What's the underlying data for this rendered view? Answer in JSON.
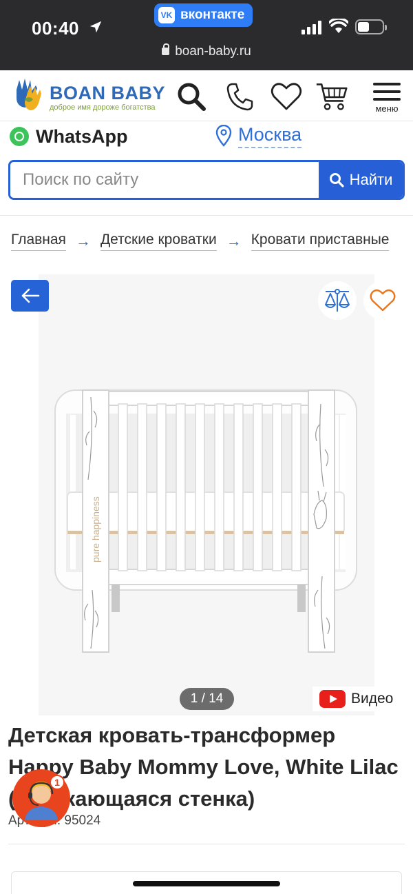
{
  "status_bar": {
    "time": "00:40",
    "back_app": "вконтакте",
    "vk_glyph": "VK",
    "url": "boan-baby.ru"
  },
  "header": {
    "logo_name": "BOAN BABY",
    "logo_tagline": "доброе имя дороже богатства",
    "menu_label": "меню",
    "icons": [
      "search-icon",
      "phone-icon",
      "heart-icon",
      "cart-icon",
      "menu-icon"
    ]
  },
  "contacts": {
    "whatsapp_label": "WhatsApp",
    "city": "Москва"
  },
  "search": {
    "placeholder": "Поиск по сайту",
    "button_label": "Найти"
  },
  "breadcrumbs": [
    "Главная",
    "Детские кроватки",
    "Кровати приставные"
  ],
  "gallery": {
    "counter": "1 / 14",
    "video_label": "Видео",
    "image_text": "pure happiness"
  },
  "product": {
    "title": "Детская кровать-трансформер Happy Baby Mommy Love, White Lilac (опускающаяся стенка)",
    "sku": "Артикул: 95024"
  },
  "chat": {
    "unread": "1"
  },
  "colors": {
    "brand_blue": "#2760d6",
    "status_bg": "#2b2b2d",
    "accent_orange": "#e8451e",
    "youtube_red": "#e8201c"
  }
}
